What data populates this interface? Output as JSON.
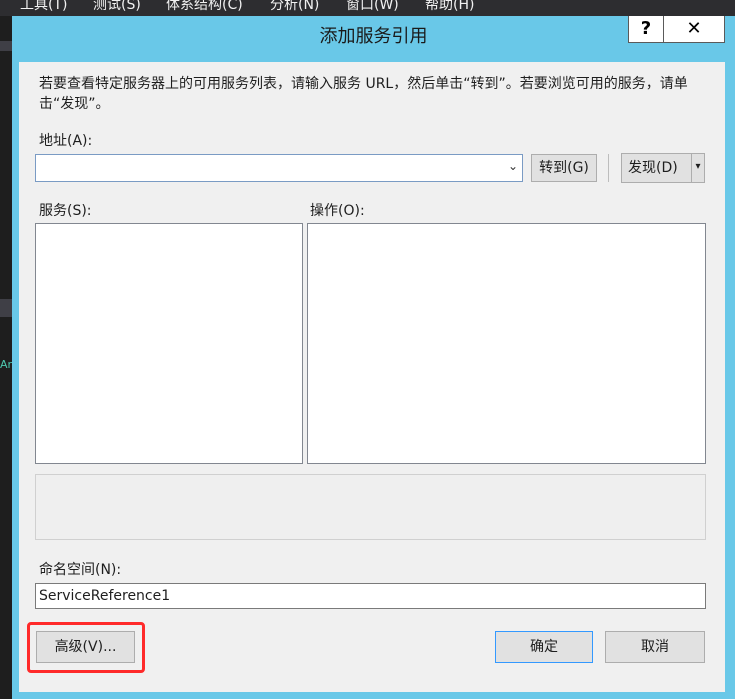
{
  "ide_menu": [
    "工具(T)",
    "测试(S)",
    "体系结构(C)",
    "分析(N)",
    "窗口(W)",
    "帮助(H)"
  ],
  "ide_glyph": "Ar",
  "dialog": {
    "title": "添加服务引用",
    "help_label": "?",
    "close_label": "✕",
    "description": "若要查看特定服务器上的可用服务列表，请输入服务 URL，然后单击“转到”。若要浏览可用的服务，请单击“发现”。",
    "address": {
      "label": "地址(A):",
      "value": "",
      "dropdown_arrow": "⌄"
    },
    "go_button": "转到(G)",
    "discover_button": "发现(D)",
    "discover_split_arrow": "▾",
    "services": {
      "label": "服务(S):",
      "items": []
    },
    "operations": {
      "label": "操作(O):",
      "items": []
    },
    "status_text": "",
    "namespace": {
      "label": "命名空间(N):",
      "value": "ServiceReference1"
    },
    "advanced_button": "高级(V)...",
    "ok_button": "确定",
    "cancel_button": "取消",
    "highlight_color": "#ff2a2a",
    "title_bar_color": "#69c8e8"
  }
}
